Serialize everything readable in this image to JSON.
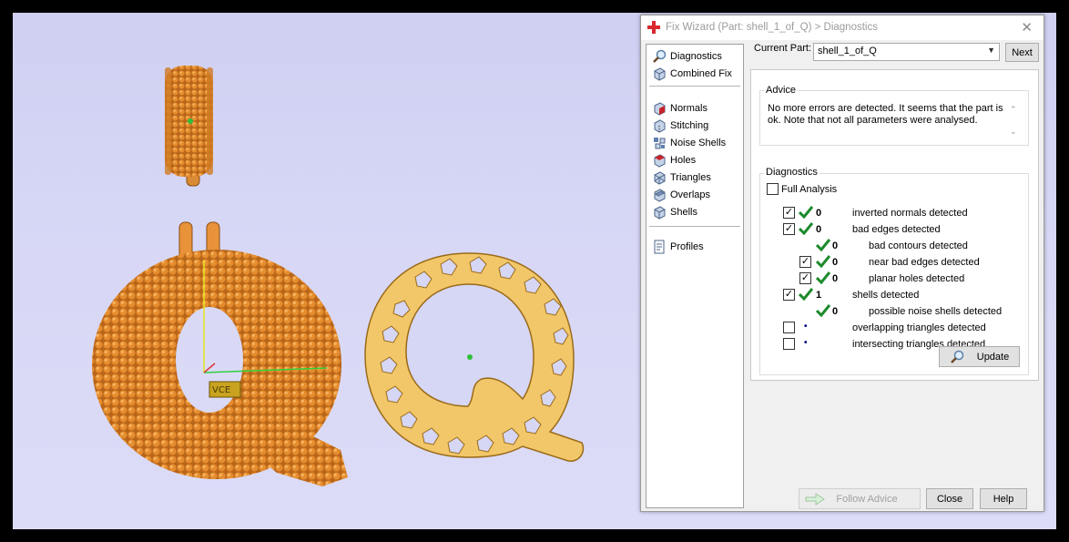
{
  "viewport": {
    "background": "#d6d6f5",
    "object_color": "#e08a2a",
    "label_tag": "VCE"
  },
  "dialog": {
    "title": "Fix Wizard (Part: shell_1_of_Q) > Diagnostics",
    "close_icon": "close-icon",
    "sidebar": {
      "items": [
        {
          "label": "Diagnostics",
          "icon": "magnifier-icon"
        },
        {
          "label": "Combined Fix",
          "icon": "combined-fix-icon"
        },
        {
          "label": "Normals",
          "icon": "normals-icon"
        },
        {
          "label": "Stitching",
          "icon": "stitching-icon"
        },
        {
          "label": "Noise Shells",
          "icon": "noise-shells-icon"
        },
        {
          "label": "Holes",
          "icon": "holes-icon"
        },
        {
          "label": "Triangles",
          "icon": "triangles-icon"
        },
        {
          "label": "Overlaps",
          "icon": "overlaps-icon"
        },
        {
          "label": "Shells",
          "icon": "shells-icon"
        },
        {
          "label": "Profiles",
          "icon": "profiles-icon"
        }
      ]
    },
    "current_part_label": "Current Part:",
    "current_part_value": "shell_1_of_Q",
    "next_label": "Next",
    "advice": {
      "title": "Advice",
      "text": "No more errors are detected. It seems that the part is ok. Note that not all parameters were analysed."
    },
    "diagnostics": {
      "title": "Diagnostics",
      "full_analysis_label": "Full Analysis",
      "full_analysis_checked": false,
      "rows": [
        {
          "label": "inverted normals detected",
          "count": "0",
          "checkbox": true,
          "checked": true,
          "status": "ok"
        },
        {
          "label": "bad edges detected",
          "count": "0",
          "checkbox": true,
          "checked": true,
          "status": "ok"
        },
        {
          "label": "bad contours detected",
          "count": "0",
          "checkbox": false,
          "checked": false,
          "status": "ok"
        },
        {
          "label": "near bad edges detected",
          "count": "0",
          "checkbox": true,
          "checked": true,
          "status": "ok"
        },
        {
          "label": "planar holes detected",
          "count": "0",
          "checkbox": true,
          "checked": true,
          "status": "ok"
        },
        {
          "label": "shells detected",
          "count": "1",
          "checkbox": true,
          "checked": true,
          "status": "ok"
        },
        {
          "label": "possible noise shells detected",
          "count": "0",
          "checkbox": false,
          "checked": false,
          "status": "ok"
        },
        {
          "label": "overlapping triangles detected",
          "count": "•",
          "checkbox": true,
          "checked": false,
          "status": "none"
        },
        {
          "label": "intersecting triangles detected",
          "count": "•",
          "checkbox": true,
          "checked": false,
          "status": "none"
        }
      ],
      "check_color": "#1c8a2b"
    },
    "update_label": "Update",
    "follow_advice_label": "Follow Advice",
    "close_label": "Close",
    "help_label": "Help"
  }
}
